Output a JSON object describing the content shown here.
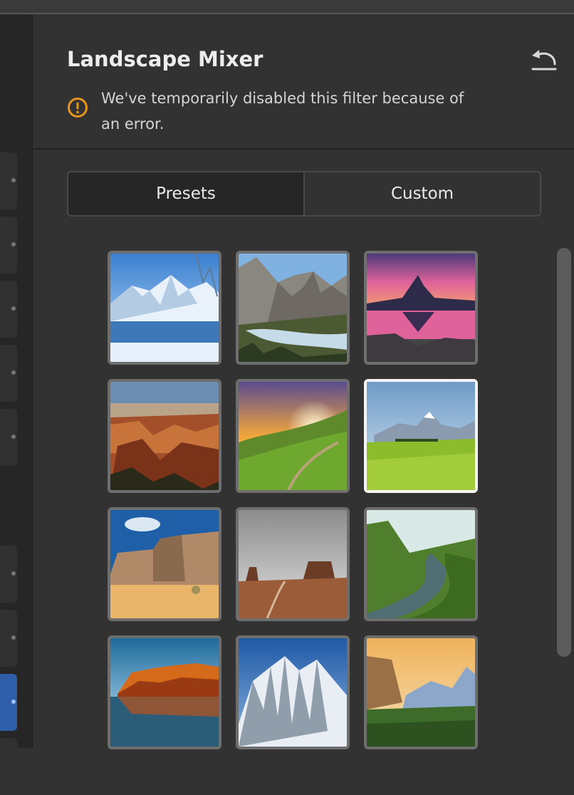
{
  "panel": {
    "title": "Landscape Mixer",
    "alert_message": "We've temporarily disabled this filter because of an error."
  },
  "icons": {
    "reset": "undo-arrow-icon",
    "alert": "warning-circle-icon"
  },
  "colors": {
    "warning": "#e8951e",
    "selected_border": "#f4f4f4",
    "active_strip": "#2f5ea8"
  },
  "tabs": [
    {
      "label": "Presets",
      "selected": true
    },
    {
      "label": "Custom",
      "selected": false
    }
  ],
  "presets": [
    {
      "scene": "snowy-mountain-lake",
      "selected": false
    },
    {
      "scene": "glacier-valley-river",
      "selected": false
    },
    {
      "scene": "matterhorn-sunset-reflection",
      "selected": false
    },
    {
      "scene": "grand-canyon",
      "selected": false
    },
    {
      "scene": "sunrise-green-hills",
      "selected": false
    },
    {
      "scene": "alpine-meadow",
      "selected": true
    },
    {
      "scene": "desert-cliffs",
      "selected": false
    },
    {
      "scene": "monument-valley",
      "selected": false
    },
    {
      "scene": "green-river-valley",
      "selected": false
    },
    {
      "scene": "autumn-lake-forest",
      "selected": false
    },
    {
      "scene": "snowy-peaks",
      "selected": false
    },
    {
      "scene": "yosemite-valley",
      "selected": false
    }
  ]
}
